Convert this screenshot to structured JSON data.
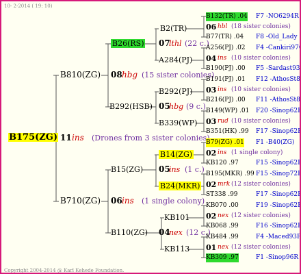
{
  "header": "10- 2-2014 ( 19: 10)",
  "footer": "Copyright 2004-2014 @ Karl Kehede Foundation.",
  "colors": {
    "frame": "#d6197a",
    "highlight_green": "#2eda2e",
    "highlight_yellow": "#ffff00",
    "recessive": "#cc0000",
    "sisters": "#7030a0",
    "info": "#0000cc"
  },
  "root": {
    "name": "B175(ZG)",
    "year": "11",
    "mark": "ins",
    "note": "(Drones from 3 sister colonies)"
  },
  "g1": {
    "top": {
      "name": "B810(ZG)",
      "year": "08",
      "mark": "hbg",
      "note": "(15 sister colonies)"
    },
    "bottom": {
      "name": "B710(ZG)",
      "year": "06",
      "mark": "ins",
      "note": "(1 single colony)"
    }
  },
  "g2": {
    "a": {
      "name": "B26(RS)",
      "year": "07",
      "mark": "lthl",
      "note": "(22 c.)"
    },
    "b": {
      "name": "B292(HSB)",
      "year": "05",
      "mark": "hbg",
      "note": "(9 c.)"
    },
    "c": {
      "name": "B15(ZG)",
      "year": "05",
      "mark": "ins",
      "note": "(1 c.)"
    },
    "d": {
      "name": "B110(ZG)",
      "year": "04",
      "mark": "nex",
      "note": "(12 c.)"
    }
  },
  "g3": {
    "a1": "B2(TR)",
    "a2": "A284(PJ)",
    "b1": "B292(PJ)",
    "b2": "B339(WP)",
    "c1": "B14(ZG)",
    "c2": "B24(MKR)",
    "d1": "KB101",
    "d2": "KB113"
  },
  "g4": [
    {
      "top": "B132(TR) .04",
      "top_info": "F7 -NO6294R",
      "year": "06",
      "mark": "hbl",
      "note": "(18 sister colonies)",
      "bottom": "B77(TR) .04",
      "bottom_info": "F8 -Old_Lady"
    },
    {
      "top": "A256(PJ) .02",
      "top_info": "F4 -Cankiri97Q",
      "year": "04",
      "mark": "ins",
      "note": "(10 sister colonies)",
      "bottom": "B190(PJ) .00",
      "bottom_info": "F5 -Sardast93R"
    },
    {
      "top": "B191(PJ) .01",
      "top_info": "F12 -AthosSt80R",
      "year": "03",
      "mark": "ins",
      "note": "(10 sister colonies)",
      "bottom": "B216(PJ) .00",
      "bottom_info": "F11 -AthosSt80R"
    },
    {
      "top": "B149(WP) .01",
      "top_info": "F20 -Sinop62R",
      "year": "03",
      "mark": "rud",
      "note": "(10 sister colonies)",
      "bottom": "B351(HK) .99",
      "bottom_info": "F17 -Sinop62R"
    },
    {
      "top": "B79(ZG) .01",
      "top_info": "F1 -B40(ZG)",
      "year": "02",
      "mark": "ins",
      "note": "(1 single colony)",
      "bottom": "KB120 .97",
      "bottom_info": "F15 -Sinop62R"
    },
    {
      "top": "B195(MKR) .99",
      "top_info": "F15 -Sinop72R",
      "year": "02",
      "mark": "mrk",
      "note": "(12 sister colonies)",
      "bottom": "ST338 .99",
      "bottom_info": "F17 -Sinop62R"
    },
    {
      "top": "KB070 .00",
      "top_info": "F19 -Sinop62R",
      "year": "02",
      "mark": "nex",
      "note": "(12 sister colonies)",
      "bottom": "KB068 .99",
      "bottom_info": "F16 -Sinop62R"
    },
    {
      "top": "KB484 .99",
      "top_info": "F4 -Maced93R",
      "year": "01",
      "mark": "nex",
      "note": "(12 sister colonies)",
      "bottom": "KB309 .97",
      "bottom_info": "F1 -Sinop96R"
    }
  ]
}
